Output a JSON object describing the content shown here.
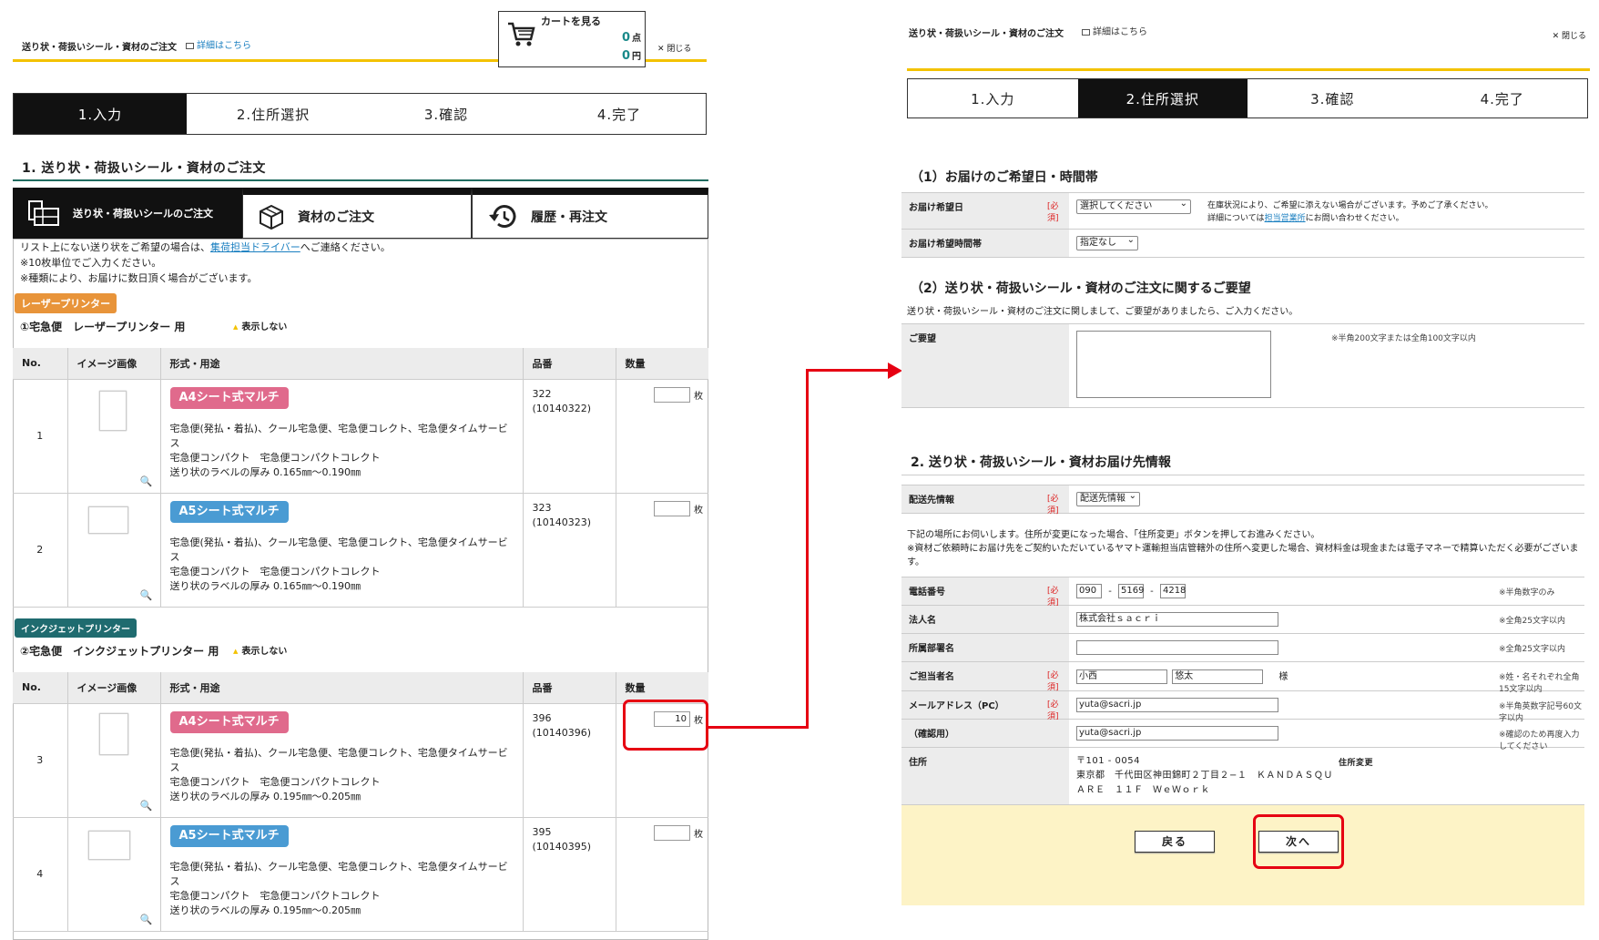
{
  "header": {
    "title": "送り状・荷扱いシール・資材のご注文",
    "detail_link": "詳細はこちら",
    "close_label": "閉じる",
    "cart_label": "カートを見る",
    "cart_count": "0",
    "cart_count_unit": "点",
    "cart_amount": "0",
    "cart_amount_unit": "円"
  },
  "steps": [
    "1.入力",
    "2.住所選択",
    "3.確認",
    "4.完了"
  ],
  "left": {
    "section_title": "1. 送り状・荷扱いシール・資材のご注文",
    "tabs": [
      "送り状・荷扱いシールのご注文",
      "資材のご注文",
      "履歴・再注文"
    ],
    "notes": {
      "line1_pre": "リスト上にない送り状をご希望の場合は、",
      "line1_link": "集荷担当ドライバー",
      "line1_post": "へご連絡ください。",
      "line2": "※10枚単位でご入力ください。",
      "line3": "※種類により、お届けに数日頂く場合がございます。"
    },
    "groups": [
      {
        "badge": "レーザープリンター",
        "badge_color": "#e8943a",
        "subtitle": "①宅急便　レーザープリンター 用",
        "toggle": "表示しない",
        "headers": [
          "No.",
          "イメージ画像",
          "形式・用途",
          "品番",
          "数量"
        ],
        "rows": [
          {
            "no": "1",
            "type": "A4シート式マルチ",
            "desc1": "宅急便(発払・着払)、クール宅急便、宅急便コレクト、宅急便タイムサービス",
            "desc2": "宅急便コンパクト　宅急便コンパクトコレクト",
            "desc3": "送り状のラベルの厚み 0.165㎜〜0.190㎜",
            "code": "322",
            "code2": "(10140322)",
            "qty": "",
            "unit": "枚"
          },
          {
            "no": "2",
            "type": "A5シート式マルチ",
            "desc1": "宅急便(発払・着払)、クール宅急便、宅急便コレクト、宅急便タイムサービス",
            "desc2": "宅急便コンパクト　宅急便コンパクトコレクト",
            "desc3": "送り状のラベルの厚み 0.165㎜〜0.190㎜",
            "code": "323",
            "code2": "(10140323)",
            "qty": "",
            "unit": "枚"
          }
        ]
      },
      {
        "badge": "インクジェットプリンター",
        "badge_color": "#1f6b6f",
        "subtitle": "②宅急便　インクジェットプリンター 用",
        "toggle": "表示しない",
        "headers": [
          "No.",
          "イメージ画像",
          "形式・用途",
          "品番",
          "数量"
        ],
        "rows": [
          {
            "no": "3",
            "type": "A4シート式マルチ",
            "desc1": "宅急便(発払・着払)、クール宅急便、宅急便コレクト、宅急便タイムサービス",
            "desc2": "宅急便コンパクト　宅急便コンパクトコレクト",
            "desc3": "送り状のラベルの厚み 0.195㎜〜0.205㎜",
            "code": "396",
            "code2": "(10140396)",
            "qty": "10",
            "unit": "枚"
          },
          {
            "no": "4",
            "type": "A5シート式マルチ",
            "desc1": "宅急便(発払・着払)、クール宅急便、宅急便コレクト、宅急便タイムサービス",
            "desc2": "宅急便コンパクト　宅急便コンパクトコレクト",
            "desc3": "送り状のラベルの厚み 0.195㎜〜0.205㎜",
            "code": "395",
            "code2": "(10140395)",
            "qty": "",
            "unit": "枚"
          }
        ]
      }
    ]
  },
  "right": {
    "sec1_title": "（1）お届けのご希望日・時間帯",
    "delivery_date_label": "お届け希望日",
    "delivery_date_value": "選択してください",
    "delivery_date_note1": "在庫状況により、ご希望に添えない場合がございます。予めご了承ください。",
    "delivery_date_note2_pre": "詳細については",
    "delivery_date_note2_link": "担当営業所",
    "delivery_date_note2_post": "にお問い合わせください。",
    "delivery_time_label": "お届け希望時間帯",
    "delivery_time_value": "指定なし",
    "required": "[必須]",
    "sec2_title": "（2）送り状・荷扱いシール・資材のご注文に関するご要望",
    "sec2_desc": "送り状・荷扱いシール・資材のご注文に関しまして、ご要望がありましたら、ご入力ください。",
    "request_label": "ご要望",
    "request_hint": "※半角200文字または全角100文字以内",
    "sec3_title": "2. 送り状・荷扱いシール・資材お届け先情報",
    "dest_label": "配送先情報",
    "dest_value": "配送先情報",
    "dest_note1": "下記の場所にお伺いします。住所が変更になった場合、「住所変更」ボタンを押してお進みください。",
    "dest_note2": "※資材ご依頼時にお届け先をご契約いただいているヤマト運輸担当店管轄外の住所へ変更した場合、資材料金は現金または電子マネーで精算いただく必要がございます。",
    "phone_label": "電話番号",
    "phone1": "090",
    "phone2": "5169",
    "phone3": "4218",
    "phone_sep": "-",
    "phone_hint": "※半角数字のみ",
    "company_label": "法人名",
    "company_value": "株式会社ｓａｃｒｉ",
    "company_hint": "※全角25文字以内",
    "dept_label": "所属部署名",
    "dept_value": "",
    "dept_hint": "※全角25文字以内",
    "person_label": "ご担当者名",
    "last_name": "小西",
    "first_name": "悠太",
    "honorific": "様",
    "person_hint": "※姓・名それぞれ全角15文字以内",
    "email_label": "メールアドレス（PC）",
    "email_value": "yuta@sacri.jp",
    "email_hint": "※半角英数字記号60文字以内",
    "email_confirm_label": "（確認用）",
    "email_confirm_value": "yuta@sacri.jp",
    "email_confirm_hint": "※確認のため再度入力してください",
    "address_label": "住所",
    "address_zip": "〒101 - 0054",
    "address_line1": "東京都　千代田区神田錦町２丁目２−１　ＫＡＮＤＡＳＱＵ",
    "address_line2": "ＡＲＥ　１１Ｆ　ＷｅＷｏｒｋ",
    "address_change": "住所変更",
    "back_button": "戻る",
    "next_button": "次へ"
  },
  "colors": {
    "accent_yellow": "#f3c200",
    "highlight_red": "#e60012",
    "teal": "#1f6b5f",
    "button_bar": "#fdf3c6"
  }
}
